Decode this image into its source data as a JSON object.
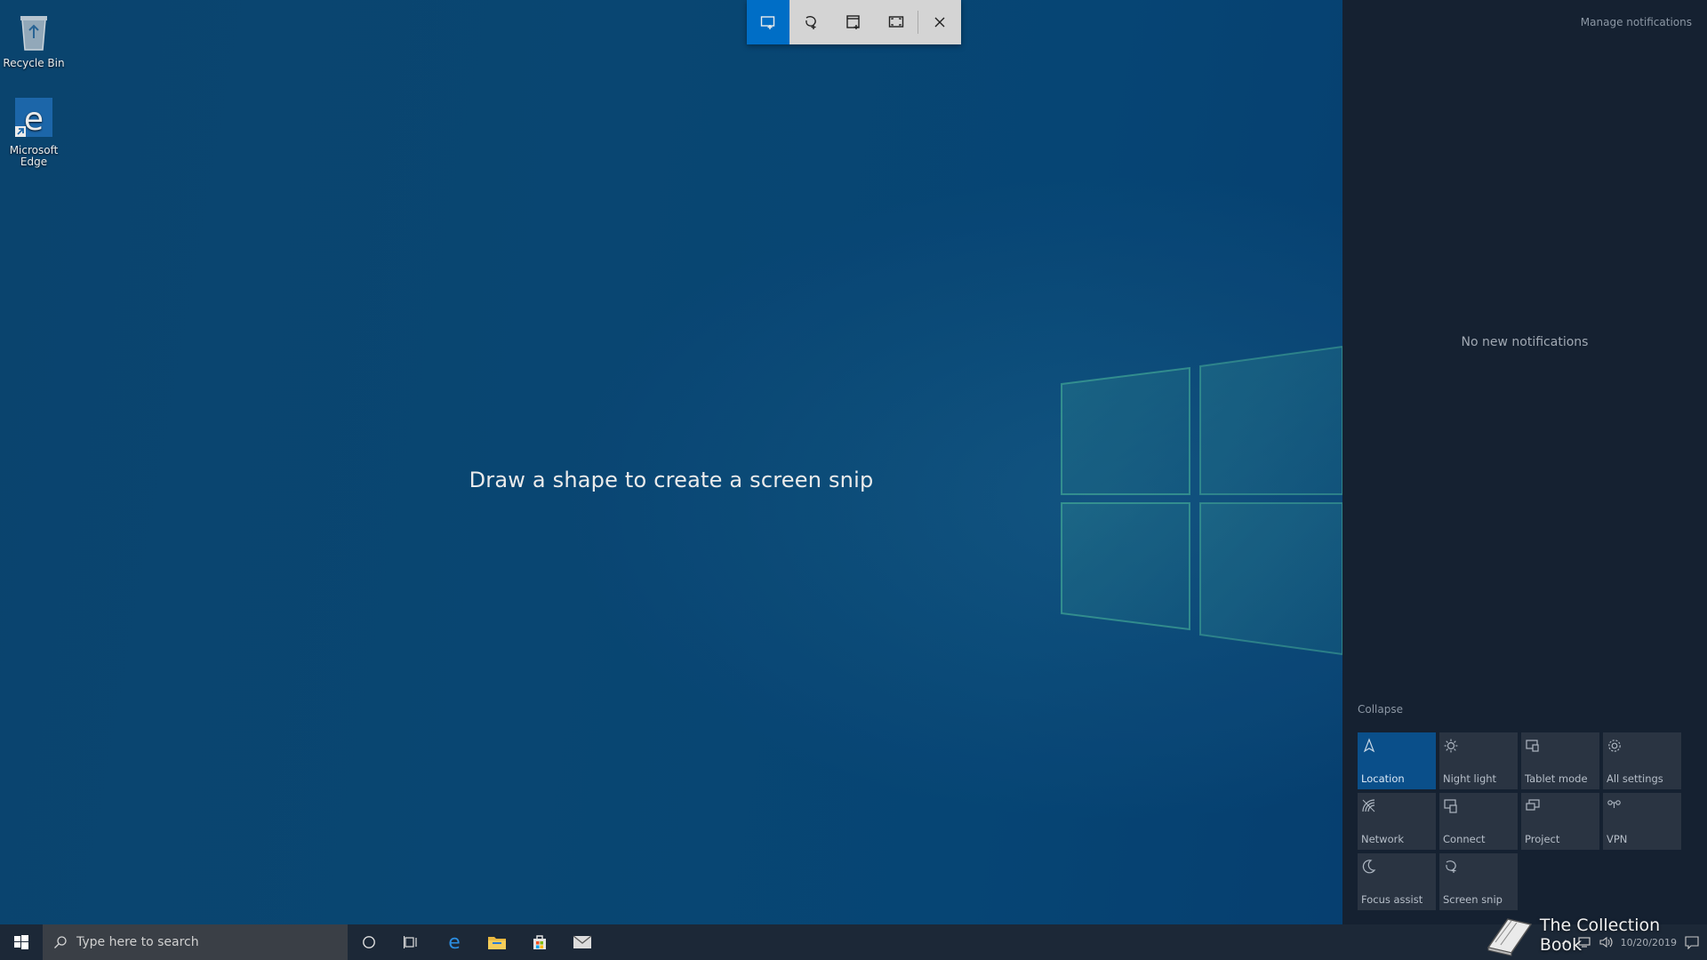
{
  "desktop": {
    "icons": [
      {
        "label": "Recycle Bin"
      },
      {
        "label": "Microsoft Edge"
      }
    ]
  },
  "snip": {
    "hint": "Draw a shape to create a screen snip",
    "tools": [
      "rectangular-snip",
      "freeform-snip",
      "window-snip",
      "fullscreen-snip",
      "close"
    ]
  },
  "action_center": {
    "manage": "Manage notifications",
    "empty": "No new notifications",
    "collapse": "Collapse",
    "tiles": [
      {
        "label": "Location",
        "icon": "location-icon",
        "active": true
      },
      {
        "label": "Night light",
        "icon": "night-light-icon",
        "active": false
      },
      {
        "label": "Tablet mode",
        "icon": "tablet-mode-icon",
        "active": false
      },
      {
        "label": "All settings",
        "icon": "gear-icon",
        "active": false
      },
      {
        "label": "Network",
        "icon": "network-icon",
        "active": false
      },
      {
        "label": "Connect",
        "icon": "connect-icon",
        "active": false
      },
      {
        "label": "Project",
        "icon": "project-icon",
        "active": false
      },
      {
        "label": "VPN",
        "icon": "vpn-icon",
        "active": false
      },
      {
        "label": "Focus assist",
        "icon": "moon-icon",
        "active": false
      },
      {
        "label": "Screen snip",
        "icon": "screen-snip-icon",
        "active": false
      }
    ]
  },
  "taskbar": {
    "search_placeholder": "Type here to search",
    "date": "10/20/2019"
  },
  "watermark": "The Collection Book",
  "colors": {
    "accent": "#0078d7",
    "action_center_bg": "#152131",
    "tile_bg": "#2a3442",
    "tile_active_bg": "#0a4f8a"
  }
}
